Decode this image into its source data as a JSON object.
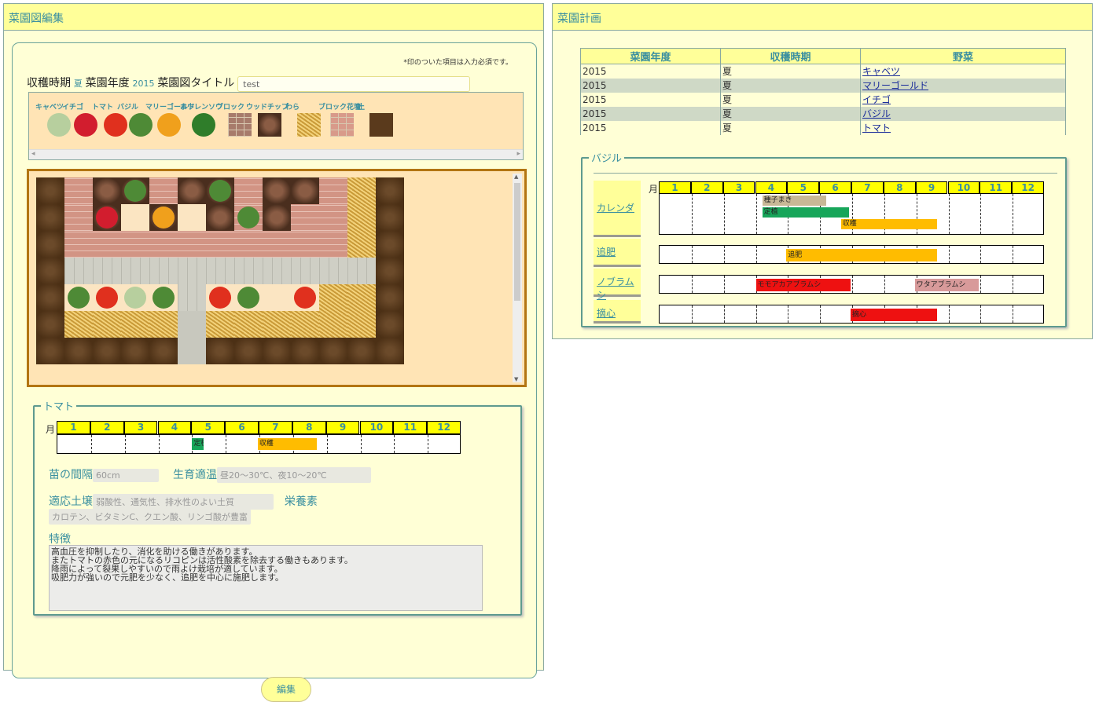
{
  "left_panel": {
    "title": "菜園図編集",
    "required_note": "*印のついた項目は入力必須です。",
    "fields": {
      "harvest_label": "収穫時期",
      "harvest_value": "夏",
      "year_label": "菜園年度",
      "year_value": "2015",
      "title_label": "菜園図タイトル",
      "title_value": "test"
    },
    "palette": [
      {
        "label": "キャベツ",
        "icon": "cabbage-icon",
        "color": "#b7cf9e"
      },
      {
        "label": "イチゴ",
        "icon": "strawberry-icon",
        "color": "#d21d2e"
      },
      {
        "label": "トマト",
        "icon": "tomato-icon",
        "color": "#e0301e"
      },
      {
        "label": "バジル",
        "icon": "basil-icon",
        "color": "#4e8a36"
      },
      {
        "label": "マリーゴールド",
        "icon": "marigold-icon",
        "color": "#f0a01c"
      },
      {
        "label": "ホウレンソウ",
        "icon": "spinach-icon",
        "color": "#2f7d2a"
      },
      {
        "label": "ブロック",
        "icon": "block-icon",
        "color": "#a77b6b"
      },
      {
        "label": "ウッドチップ",
        "icon": "woodchip-icon",
        "color": "#6b4632"
      },
      {
        "label": "わら",
        "icon": "straw-icon",
        "color": "#e0b756"
      },
      {
        "label": "ブロック花壇",
        "icon": "brick-bed-icon",
        "color": "#d89a8a"
      },
      {
        "label": "土",
        "icon": "soil-icon",
        "color": "#5a3a1c"
      }
    ],
    "detail": {
      "legend": "トマト",
      "month_label": "月",
      "months": [
        "1",
        "2",
        "3",
        "4",
        "5",
        "6",
        "7",
        "8",
        "9",
        "10",
        "11",
        "12"
      ],
      "bars": [
        {
          "label": "定植",
          "start": 4.0,
          "end": 4.35,
          "color": "#17a65a"
        },
        {
          "label": "収穫",
          "start": 5.95,
          "end": 7.7,
          "color": "#ffbc00"
        }
      ],
      "spacing_label": "苗の間隔",
      "spacing_value": "60cm",
      "temp_label": "生育適温",
      "temp_value": "昼20〜30℃、夜10〜20℃",
      "soil_label": "適応土壌",
      "soil_value": "弱酸性、通気性、排水性のよい土質",
      "nutrient_label": "栄養素",
      "nutrient_value": "カロテン、ビタミンC、クエン酸、リンゴ酸が豊富",
      "feature_label": "特徴",
      "feature_text": "高血圧を抑制したり、消化を助ける働きがあります。\nまたトマトの赤色の元になるリコピンは活性酸素を除去する働きもあります。\n降雨によって裂果しやすいので雨よけ栽培が適しています。\n吸肥力が強いので元肥を少なく、追肥を中心に施肥します。"
    },
    "edit_button": "編集"
  },
  "right_panel": {
    "title": "菜園計画",
    "table": {
      "headers": [
        "菜園年度",
        "収穫時期",
        "野菜"
      ],
      "rows": [
        [
          "2015",
          "夏",
          "キャベツ"
        ],
        [
          "2015",
          "夏",
          "マリーゴールド"
        ],
        [
          "2015",
          "夏",
          "イチゴ"
        ],
        [
          "2015",
          "夏",
          "バジル"
        ],
        [
          "2015",
          "夏",
          "トマト"
        ]
      ]
    },
    "detail": {
      "legend": "バジル",
      "month_label": "月",
      "months": [
        "1",
        "2",
        "3",
        "4",
        "5",
        "6",
        "7",
        "8",
        "9",
        "10",
        "11",
        "12"
      ],
      "rows": [
        {
          "label": "カレンダ",
          "bars": [
            {
              "label": "種子まき",
              "start": 3.2,
              "end": 5.2,
              "color": "#c8b896"
            },
            {
              "label": "定植",
              "start": 3.2,
              "end": 5.9,
              "color": "#17a65a"
            },
            {
              "label": "収穫",
              "start": 5.65,
              "end": 8.65,
              "color": "#ffbc00"
            }
          ]
        },
        {
          "label": "追肥",
          "bars": [
            {
              "label": "追肥",
              "start": 3.95,
              "end": 8.65,
              "color": "#ffbc00"
            }
          ]
        },
        {
          "label": "ノブラムシ",
          "bars": [
            {
              "label": "モモアカアブラムシ",
              "start": 3.0,
              "end": 5.95,
              "color": "#ee1111"
            },
            {
              "label": "ワタアブラムシ",
              "start": 7.95,
              "end": 9.95,
              "color": "#d89a9a"
            }
          ]
        },
        {
          "label": "摘心",
          "bars": [
            {
              "label": "摘心",
              "start": 5.95,
              "end": 8.65,
              "color": "#ee1111"
            }
          ]
        }
      ]
    }
  }
}
